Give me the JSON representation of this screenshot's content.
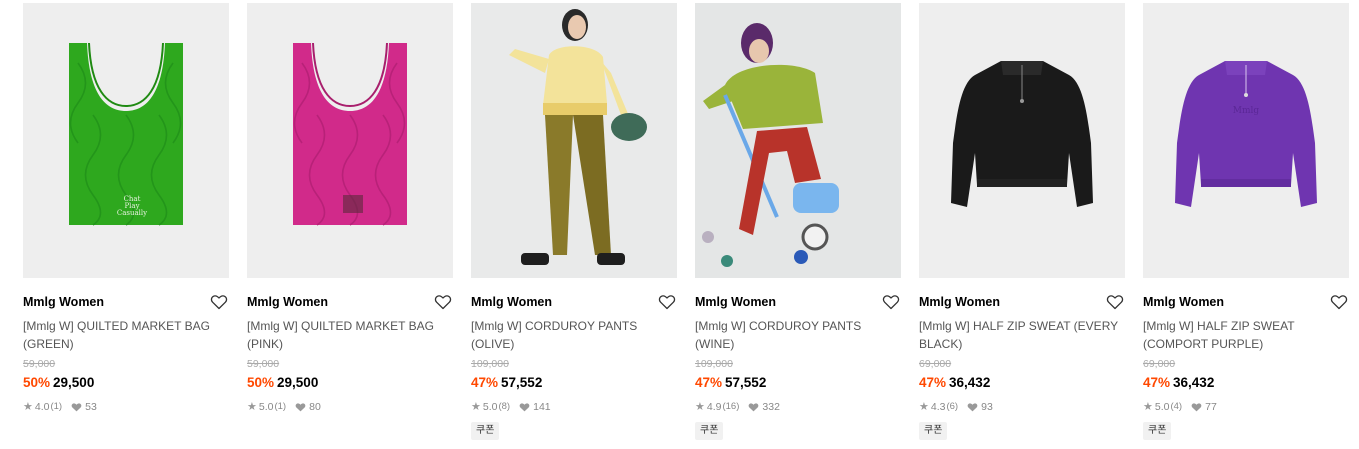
{
  "products": [
    {
      "brand": "Mmlg Women",
      "name": "[Mmlg W] QUILTED MARKET BAG (GREEN)",
      "original_price": "59,000",
      "discount": "50%",
      "price": "29,500",
      "rating": "4.0",
      "review_count": "(1)",
      "likes": "53",
      "coupon": "",
      "image": "green-quilted-bag",
      "heart_icon": "heart-outline-icon"
    },
    {
      "brand": "Mmlg Women",
      "name": "[Mmlg W] QUILTED MARKET BAG (PINK)",
      "original_price": "59,000",
      "discount": "50%",
      "price": "29,500",
      "rating": "5.0",
      "review_count": "(1)",
      "likes": "80",
      "coupon": "",
      "image": "pink-quilted-bag",
      "heart_icon": "heart-outline-icon"
    },
    {
      "brand": "Mmlg Women",
      "name": "[Mmlg W] CORDUROY PANTS (OLIVE)",
      "original_price": "109,000",
      "discount": "47%",
      "price": "57,552",
      "rating": "5.0",
      "review_count": "(8)",
      "likes": "141",
      "coupon": "쿠폰",
      "image": "model-olive-corduroy",
      "heart_icon": "heart-outline-icon"
    },
    {
      "brand": "Mmlg Women",
      "name": "[Mmlg W] CORDUROY PANTS (WINE)",
      "original_price": "109,000",
      "discount": "47%",
      "price": "57,552",
      "rating": "4.9",
      "review_count": "(16)",
      "likes": "332",
      "coupon": "쿠폰",
      "image": "model-wine-corduroy",
      "heart_icon": "heart-outline-icon"
    },
    {
      "brand": "Mmlg Women",
      "name": "[Mmlg W] HALF ZIP SWEAT (EVERY BLACK)",
      "original_price": "69,000",
      "discount": "47%",
      "price": "36,432",
      "rating": "4.3",
      "review_count": "(6)",
      "likes": "93",
      "coupon": "쿠폰",
      "image": "black-half-zip-sweat",
      "heart_icon": "heart-outline-icon"
    },
    {
      "brand": "Mmlg Women",
      "name": "[Mmlg W] HALF ZIP SWEAT (COMPORT PURPLE)",
      "original_price": "69,000",
      "discount": "47%",
      "price": "36,432",
      "rating": "5.0",
      "review_count": "(4)",
      "likes": "77",
      "coupon": "쿠폰",
      "image": "purple-half-zip-sweat",
      "heart_icon": "heart-outline-icon"
    }
  ],
  "colors": {
    "discount": "#ff4800",
    "brand": "#000000",
    "name": "#555555",
    "meta": "#888888",
    "thumb_bg": "#eeeeee"
  },
  "icons": {
    "star": "star-icon",
    "like": "heart-filled-icon"
  }
}
